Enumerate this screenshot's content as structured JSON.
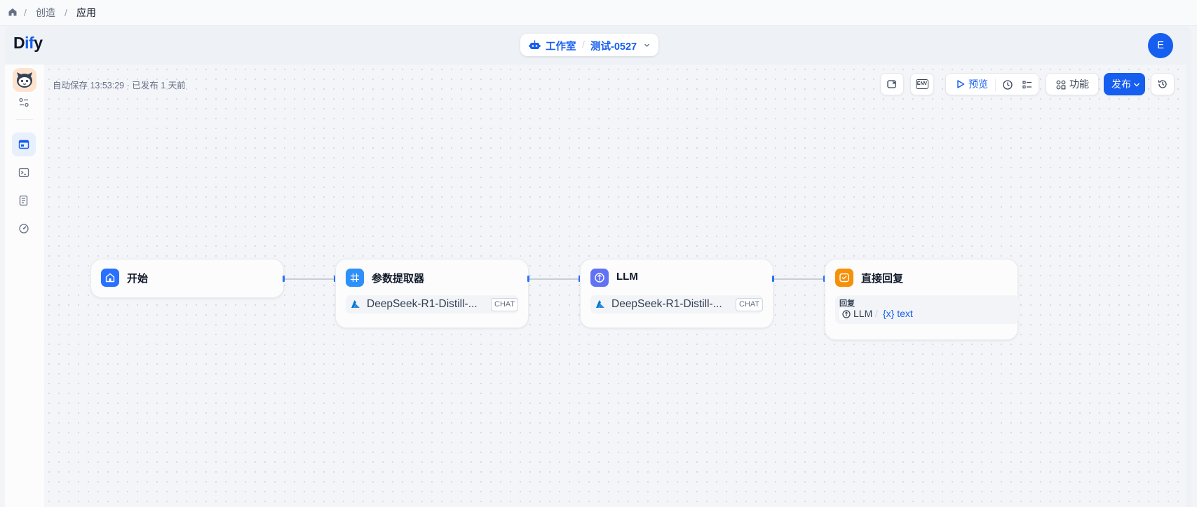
{
  "breadcrumb": {
    "items": [
      "创造",
      "应用"
    ]
  },
  "logo": {
    "text_d": "D",
    "text_if": "if",
    "text_y": "y"
  },
  "studio": {
    "label": "工作室",
    "app_name": "测试-0527"
  },
  "user": {
    "avatar_letter": "E"
  },
  "status": {
    "autosave": "自动保存 13:53:29 · 已发布 1 天前"
  },
  "toolbar": {
    "env_label": "ENV",
    "preview_label": "预览",
    "features_label": "功能",
    "publish_label": "发布"
  },
  "nodes": {
    "start": {
      "title": "开始"
    },
    "extractor": {
      "title": "参数提取器",
      "model": "DeepSeek-R1-Distill-...",
      "badge": "CHAT"
    },
    "llm": {
      "title": "LLM",
      "model": "DeepSeek-R1-Distill-...",
      "badge": "CHAT"
    },
    "answer": {
      "title": "直接回复",
      "reply_label": "回复",
      "var_node": "LLM",
      "var_sep": "/",
      "var_name": "{x} text"
    }
  },
  "colors": {
    "accent": "#155eef",
    "answer_icon": "#f79009",
    "llm_icon": "#6172f3",
    "extractor_icon": "#2e90fa"
  }
}
